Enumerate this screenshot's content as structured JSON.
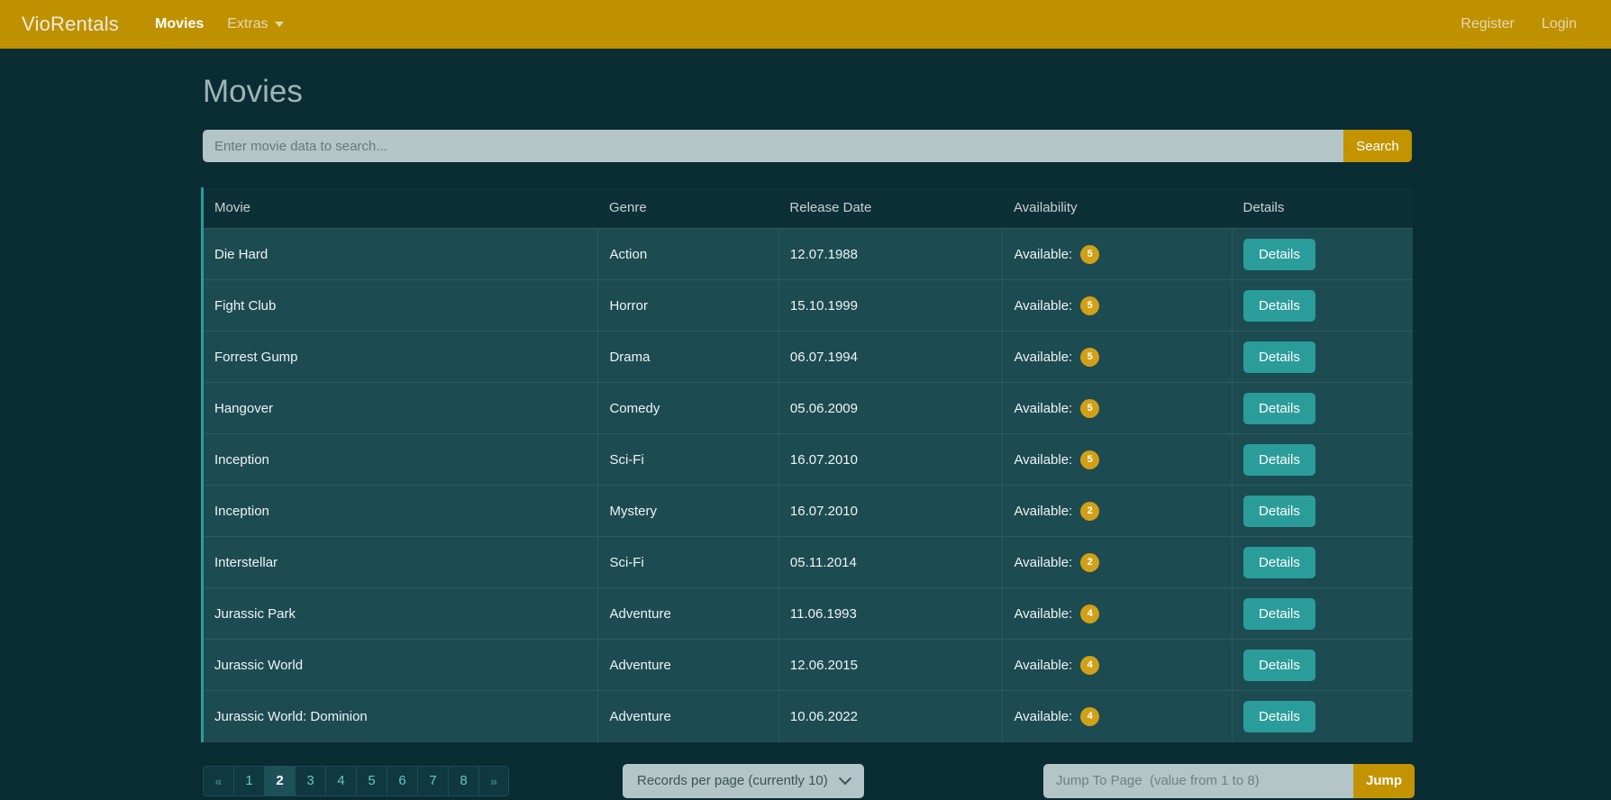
{
  "navbar": {
    "brand": "VioRentals",
    "links": [
      {
        "label": "Movies",
        "active": true
      },
      {
        "label": "Extras",
        "active": false,
        "dropdown": true
      }
    ],
    "right": [
      {
        "label": "Register"
      },
      {
        "label": "Login"
      }
    ],
    "bg_color": "#bf9000"
  },
  "page": {
    "title": "Movies",
    "bg_color": "#0a2c33",
    "accent_color": "#2a9d9a"
  },
  "search": {
    "placeholder": "Enter movie data to search...",
    "value": "",
    "button_label": "Search"
  },
  "table": {
    "columns": [
      "Movie",
      "Genre",
      "Release Date",
      "Availability",
      "Details"
    ],
    "availability_prefix": "Available:",
    "details_label": "Details",
    "rows": [
      {
        "movie": "Die Hard",
        "genre": "Action",
        "release_date": "12.07.1988",
        "available": "5"
      },
      {
        "movie": "Fight Club",
        "genre": "Horror",
        "release_date": "15.10.1999",
        "available": "5"
      },
      {
        "movie": "Forrest Gump",
        "genre": "Drama",
        "release_date": "06.07.1994",
        "available": "5"
      },
      {
        "movie": "Hangover",
        "genre": "Comedy",
        "release_date": "05.06.2009",
        "available": "5"
      },
      {
        "movie": "Inception",
        "genre": "Sci-Fi",
        "release_date": "16.07.2010",
        "available": "5"
      },
      {
        "movie": "Inception",
        "genre": "Mystery",
        "release_date": "16.07.2010",
        "available": "2"
      },
      {
        "movie": "Interstellar",
        "genre": "Sci-Fi",
        "release_date": "05.11.2014",
        "available": "2"
      },
      {
        "movie": "Jurassic Park",
        "genre": "Adventure",
        "release_date": "11.06.1993",
        "available": "4"
      },
      {
        "movie": "Jurassic World",
        "genre": "Adventure",
        "release_date": "12.06.2015",
        "available": "4"
      },
      {
        "movie": "Jurassic World: Dominion",
        "genre": "Adventure",
        "release_date": "10.06.2022",
        "available": "4"
      }
    ]
  },
  "pagination": {
    "prev_label": "«",
    "next_label": "»",
    "pages": [
      "1",
      "2",
      "3",
      "4",
      "5",
      "6",
      "7",
      "8"
    ],
    "active_page": "2"
  },
  "records_per_page": {
    "label": "Records per page (currently 10)",
    "icon": "chevron-down-icon"
  },
  "jump": {
    "placeholder": "Jump To Page  (value from 1 to 8)",
    "value": "",
    "button_label": "Jump"
  }
}
